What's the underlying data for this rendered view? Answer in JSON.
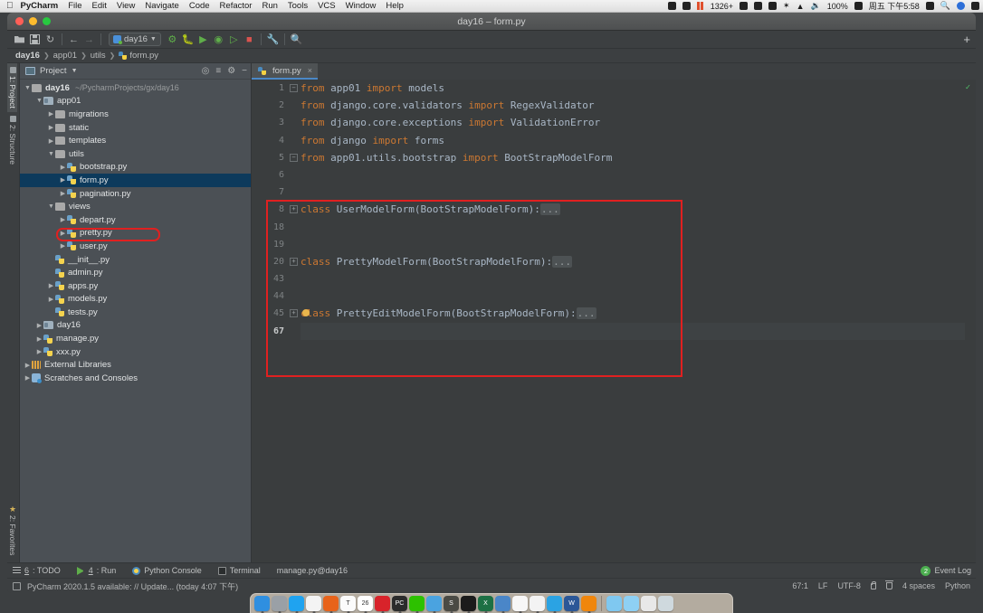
{
  "macos": {
    "app_name": "PyCharm",
    "menus": [
      "File",
      "Edit",
      "View",
      "Navigate",
      "Code",
      "Refactor",
      "Run",
      "Tools",
      "VCS",
      "Window",
      "Help"
    ],
    "status_items": [
      "1326+",
      "100%",
      "周五 下午5:58"
    ]
  },
  "window": {
    "title": "day16 – form.py"
  },
  "toolbar": {
    "run_config": "day16",
    "icons": [
      "open-folder-icon",
      "save-icon",
      "sync-icon",
      "back-arrow-icon",
      "forward-arrow-icon",
      "build-icon",
      "debug-icon",
      "run-with-coverage-icon",
      "profile-icon",
      "run-tests-icon",
      "stop-icon",
      "settings-wrench-icon",
      "search-icon"
    ],
    "add_label": "+"
  },
  "breadcrumb": {
    "items": [
      "day16",
      "app01",
      "utils",
      "form.py"
    ]
  },
  "vtabs": {
    "top": [
      {
        "label": "1: Project",
        "selected": true
      },
      {
        "label": "2: Structure",
        "selected": false
      }
    ],
    "bottom": {
      "label": "2: Favorites"
    }
  },
  "project_panel": {
    "title": "Project",
    "tree": [
      {
        "indent": 0,
        "arrow": "down",
        "icon": "folder",
        "name": "day16",
        "bold": true,
        "path": "~/PycharmProjects/gx/day16"
      },
      {
        "indent": 1,
        "arrow": "down",
        "icon": "folder-mod",
        "name": "app01"
      },
      {
        "indent": 2,
        "arrow": "right",
        "icon": "folder",
        "name": "migrations"
      },
      {
        "indent": 2,
        "arrow": "right",
        "icon": "folder",
        "name": "static"
      },
      {
        "indent": 2,
        "arrow": "right",
        "icon": "folder",
        "name": "templates"
      },
      {
        "indent": 2,
        "arrow": "down",
        "icon": "folder",
        "name": "utils"
      },
      {
        "indent": 3,
        "arrow": "right",
        "icon": "python",
        "name": "bootstrap.py"
      },
      {
        "indent": 3,
        "arrow": "right",
        "icon": "python",
        "name": "form.py",
        "selected": true
      },
      {
        "indent": 3,
        "arrow": "right",
        "icon": "python",
        "name": "pagination.py"
      },
      {
        "indent": 2,
        "arrow": "down",
        "icon": "folder",
        "name": "views"
      },
      {
        "indent": 3,
        "arrow": "right",
        "icon": "python",
        "name": "depart.py"
      },
      {
        "indent": 3,
        "arrow": "right",
        "icon": "python",
        "name": "pretty.py"
      },
      {
        "indent": 3,
        "arrow": "right",
        "icon": "python",
        "name": "user.py"
      },
      {
        "indent": 2,
        "arrow": "none",
        "icon": "python",
        "name": "__init__.py"
      },
      {
        "indent": 2,
        "arrow": "none",
        "icon": "python",
        "name": "admin.py"
      },
      {
        "indent": 2,
        "arrow": "right",
        "icon": "python",
        "name": "apps.py"
      },
      {
        "indent": 2,
        "arrow": "right",
        "icon": "python",
        "name": "models.py"
      },
      {
        "indent": 2,
        "arrow": "none",
        "icon": "python",
        "name": "tests.py"
      },
      {
        "indent": 1,
        "arrow": "right",
        "icon": "folder-mod",
        "name": "day16"
      },
      {
        "indent": 1,
        "arrow": "right",
        "icon": "python",
        "name": "manage.py"
      },
      {
        "indent": 1,
        "arrow": "right",
        "icon": "python",
        "name": "xxx.py"
      },
      {
        "indent": 0,
        "arrow": "right",
        "icon": "library",
        "name": "External Libraries"
      },
      {
        "indent": 0,
        "arrow": "right",
        "icon": "scratch",
        "name": "Scratches and Consoles"
      }
    ]
  },
  "editor": {
    "tab": {
      "label": "form.py",
      "close": "×"
    },
    "gutter": [
      "1",
      "2",
      "3",
      "4",
      "5",
      "6",
      "7",
      "8",
      "18",
      "19",
      "20",
      "43",
      "44",
      "45",
      "67"
    ],
    "current_line_index": 14,
    "lines": [
      {
        "n": "1",
        "fold": "minus",
        "parts": [
          {
            "t": "from ",
            "c": "kw"
          },
          {
            "t": "app01 ",
            "c": ""
          },
          {
            "t": "import ",
            "c": "kw"
          },
          {
            "t": "models",
            "c": ""
          }
        ]
      },
      {
        "n": "2",
        "fold": "",
        "parts": [
          {
            "t": "from ",
            "c": "kw"
          },
          {
            "t": "django.core.validators ",
            "c": ""
          },
          {
            "t": "import ",
            "c": "kw"
          },
          {
            "t": "RegexValidator",
            "c": ""
          }
        ]
      },
      {
        "n": "3",
        "fold": "",
        "parts": [
          {
            "t": "from ",
            "c": "kw"
          },
          {
            "t": "django.core.exceptions ",
            "c": ""
          },
          {
            "t": "import ",
            "c": "kw"
          },
          {
            "t": "ValidationError",
            "c": ""
          }
        ]
      },
      {
        "n": "4",
        "fold": "",
        "parts": [
          {
            "t": "from ",
            "c": "kw"
          },
          {
            "t": "django ",
            "c": ""
          },
          {
            "t": "import ",
            "c": "kw"
          },
          {
            "t": "forms",
            "c": ""
          }
        ]
      },
      {
        "n": "5",
        "fold": "minus",
        "parts": [
          {
            "t": "from ",
            "c": "kw"
          },
          {
            "t": "app01.utils.bootstrap ",
            "c": ""
          },
          {
            "t": "import ",
            "c": "kw"
          },
          {
            "t": "BootStrapModelForm",
            "c": ""
          }
        ]
      },
      {
        "n": "6",
        "fold": "",
        "parts": []
      },
      {
        "n": "7",
        "fold": "",
        "parts": []
      },
      {
        "n": "8",
        "fold": "plus",
        "parts": [
          {
            "t": "class ",
            "c": "kw"
          },
          {
            "t": "UserModelForm(BootStrapModelForm):",
            "c": ""
          },
          {
            "t": "...",
            "c": "collapsed"
          }
        ]
      },
      {
        "n": "18",
        "fold": "",
        "parts": []
      },
      {
        "n": "19",
        "fold": "",
        "parts": []
      },
      {
        "n": "20",
        "fold": "plus",
        "parts": [
          {
            "t": "class ",
            "c": "kw"
          },
          {
            "t": "PrettyModelForm(BootStrapModelForm):",
            "c": ""
          },
          {
            "t": "...",
            "c": "collapsed"
          }
        ]
      },
      {
        "n": "43",
        "fold": "",
        "parts": []
      },
      {
        "n": "44",
        "fold": "",
        "parts": []
      },
      {
        "n": "45",
        "fold": "plus",
        "bulb": true,
        "parts": [
          {
            "t": "class ",
            "c": "kw"
          },
          {
            "t": "PrettyEditModelForm(BootStrapModelForm):",
            "c": ""
          },
          {
            "t": "...",
            "c": "collapsed"
          }
        ]
      },
      {
        "n": "67",
        "fold": "",
        "parts": []
      }
    ]
  },
  "bottom_toolwindows": [
    {
      "num": "6",
      "label": ": TODO",
      "icon": "todo-icon"
    },
    {
      "num": "4",
      "label": ": Run",
      "icon": "run-icon"
    },
    {
      "num": "",
      "label": "Python Console",
      "icon": "python-console-icon"
    },
    {
      "num": "",
      "label": "Terminal",
      "icon": "terminal-icon"
    },
    {
      "num": "",
      "label": "manage.py@day16",
      "icon": ""
    }
  ],
  "event_log": {
    "count": "2",
    "label": "Event Log"
  },
  "statusbar": {
    "message": "PyCharm 2020.1.5 available: // Update... (today 4:07 下午)",
    "caret": "67:1",
    "line_sep": "LF",
    "encoding": "UTF-8",
    "indent": "4 spaces",
    "interpreter": "Python"
  },
  "dock": {
    "apps": [
      {
        "name": "finder-icon",
        "color": "#2f8fe0",
        "glyph": ""
      },
      {
        "name": "launchpad-icon",
        "color": "#9aa0a6",
        "glyph": ""
      },
      {
        "name": "safari-icon",
        "color": "#1fa3f0",
        "glyph": ""
      },
      {
        "name": "chrome-icon",
        "color": "#f4f4f4",
        "glyph": ""
      },
      {
        "name": "firefox-icon",
        "color": "#e8631a",
        "glyph": ""
      },
      {
        "name": "typora-icon",
        "color": "#fbfbfb",
        "glyph": "T"
      },
      {
        "name": "calendar-icon",
        "color": "#ffffff",
        "glyph": "26"
      },
      {
        "name": "netease-music-icon",
        "color": "#d8232a",
        "glyph": ""
      },
      {
        "name": "pycharm-icon",
        "color": "#2b2b2b",
        "glyph": "PC"
      },
      {
        "name": "wechat-icon",
        "color": "#2dc100",
        "glyph": ""
      },
      {
        "name": "keynote-icon",
        "color": "#4aa3e0",
        "glyph": ""
      },
      {
        "name": "sublime-icon",
        "color": "#4a4a44",
        "glyph": "S"
      },
      {
        "name": "iterm-icon",
        "color": "#1b1b1b",
        "glyph": ""
      },
      {
        "name": "excel-icon",
        "color": "#1d7044",
        "glyph": "X"
      },
      {
        "name": "teamviewer-icon",
        "color": "#4a86c8",
        "glyph": ""
      },
      {
        "name": "notes-icon",
        "color": "#f7f7f7",
        "glyph": ""
      },
      {
        "name": "photos-icon",
        "color": "#f3f3f3",
        "glyph": ""
      },
      {
        "name": "telegram-icon",
        "color": "#2ba3e3",
        "glyph": ""
      },
      {
        "name": "word-icon",
        "color": "#2b5797",
        "glyph": "W"
      },
      {
        "name": "thunder-icon",
        "color": "#f0860c",
        "glyph": ""
      }
    ],
    "files": [
      {
        "name": "downloads-folder-icon",
        "color": "#7fc8f0"
      },
      {
        "name": "documents-folder-icon",
        "color": "#8ed0f4"
      },
      {
        "name": "recent-item-icon",
        "color": "#e8e8e8"
      },
      {
        "name": "trash-icon",
        "color": "#cfd9de"
      }
    ]
  }
}
